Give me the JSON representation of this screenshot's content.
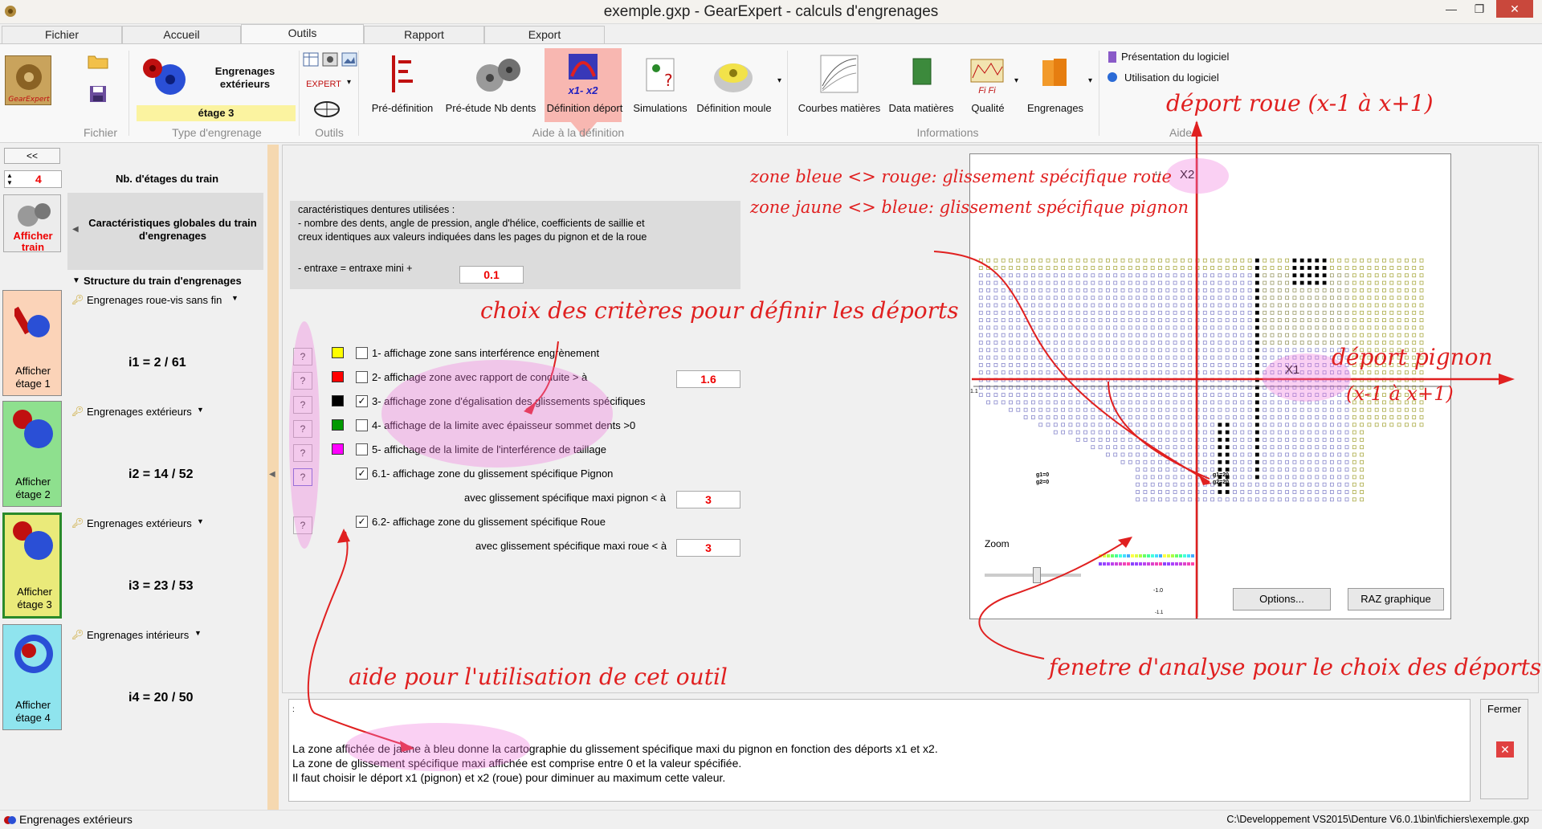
{
  "window": {
    "title": "exemple.gxp - GearExpert - calculs d'engrenages",
    "min": "—",
    "max": "❐",
    "close": "✕"
  },
  "tabs": [
    "Fichier",
    "Accueil",
    "Outils",
    "Rapport",
    "Export"
  ],
  "ribbon": {
    "logo_text": "GearExpert",
    "engrenage_label": "Engrenages extérieurs",
    "etage_label": "étage 3",
    "expert_label": "EXPERT",
    "btn_predef": "Pré-définition",
    "btn_preetude": "Pré-étude Nb dents",
    "btn_defdeport": "Définition déport",
    "btn_defdeport_icon": "x1- x2",
    "btn_simul": "Simulations",
    "btn_moule": "Définition moule",
    "btn_courbes": "Courbes matières",
    "btn_data": "Data matières",
    "btn_qualite": "Qualité",
    "btn_qualite_icon": "Fi Fi",
    "btn_engrenages": "Engrenages",
    "help_presentation": "Présentation du logiciel",
    "help_utilisation": "Utilisation du logiciel",
    "groups": [
      "Fichier",
      "Type d'engrenage",
      "Outils",
      "Aide à la définition",
      "Informations",
      "Aide"
    ]
  },
  "sidebar": {
    "collapse_btn": "<<",
    "nb_etages_value": "4",
    "nb_etages_label": "Nb. d'étages du train",
    "afficher_train": "Afficher train",
    "carac_label": "Caractéristiques globales du train d'engrenages",
    "structure_label": "Structure du train d'engrenages",
    "stages": [
      {
        "type": "Engrenages roue-vis sans fin",
        "ratio": "i1 = 2 / 61",
        "btn": "Afficher étage 1",
        "color": "#fbd3b8"
      },
      {
        "type": "Engrenages extérieurs",
        "ratio": "i2 = 14 / 52",
        "btn": "Afficher étage 2",
        "color": "#8ee08e"
      },
      {
        "type": "Engrenages extérieurs",
        "ratio": "i3 = 23 / 53",
        "btn": "Afficher étage 3",
        "color": "#eaea7a"
      },
      {
        "type": "Engrenages intérieurs",
        "ratio": "i4 = 20 / 50",
        "btn": "Afficher étage 4",
        "color": "#8fe4ee"
      }
    ]
  },
  "info": {
    "line1": "caractéristiques dentures utilisées :",
    "line2": "- nombre des dents, angle de pression, angle d'hélice, coefficients de saillie et",
    "line3": "creux identiques aux valeurs indiquées dans les pages du pignon et de la roue",
    "entraxe_label": "- entraxe = entraxe mini +",
    "entraxe_value": "0.1"
  },
  "criteria": [
    {
      "label": "1- affichage zone sans interférence engrènement",
      "swatch": "#ffff00",
      "checked": false
    },
    {
      "label": "2- affichage zone avec rapport de conduite > à",
      "swatch": "#ff0000",
      "checked": false,
      "value": "1.6"
    },
    {
      "label": "3- affichage zone d'égalisation des glissements spécifiques",
      "swatch": "#000000",
      "checked": true
    },
    {
      "label": "4- affichage de la limite avec épaisseur sommet dents >0",
      "swatch": "#009900",
      "checked": false
    },
    {
      "label": "5- affichage de la limite de l'interférence de taillage",
      "swatch": "#ff00ff",
      "checked": false
    },
    {
      "label": "6.1- affichage zone du glissement spécifique Pignon",
      "checked": true
    },
    {
      "label": "6.2- affichage zone du glissement spécifique Roue",
      "checked": true
    }
  ],
  "gs_pignon_label": "avec glissement spécifique maxi pignon < à",
  "gs_pignon_value": "3",
  "gs_roue_label": "avec glissement spécifique maxi roue < à",
  "gs_roue_value": "3",
  "qbtn": "?",
  "check": "✓",
  "graph": {
    "x2": "X2",
    "x1": "X1",
    "zoom": "Zoom",
    "options": "Options...",
    "raz": "RAZ graphique",
    "tick_top": "1.1",
    "tick_bottom": "-1.1",
    "tick_mid": "-1.0",
    "tick_left": "1.1",
    "pt_a1": "g1=0",
    "pt_a2": "g2=0",
    "pt_b1": "g1=20",
    "pt_b2": "g2=20"
  },
  "help": {
    "prefix": ":",
    "line1": "La zone affichée de jaune à bleu donne la cartographie du glissement spécifique maxi du pignon en fonction des déports x1 et x2.",
    "line2": "La zone de glissement spécifique maxi affichée est comprise entre 0 et la valeur spécifiée.",
    "line3": "Il faut choisir le déport x1 (pignon) et x2 (roue) pour diminuer au maximum cette valeur.",
    "fermer": "Fermer",
    "close_icon": "✕"
  },
  "status": {
    "left": "Engrenages extérieurs",
    "right": "C:\\Developpement VS2015\\Denture V6.0.1\\bin\\fichiers\\exemple.gxp"
  },
  "annotations": {
    "deport_roue": "déport roue (x-1 à x+1)",
    "zone_bleue": "zone bleue <> rouge: glissement spécifique roue",
    "zone_jaune": "zone jaune <> bleue: glissement spécifique pignon",
    "choix": "choix des critères pour définir les déports",
    "deport_pignon": "déport pignon",
    "deport_pignon_range": "(x-1 à x+1)",
    "aide": "aide pour l'utilisation de cet outil",
    "fenetre": "fenetre d'analyse pour le choix des déports"
  },
  "colors": {
    "annotation": "#e02020",
    "highlight": "#f07adc",
    "accent": "#c62828"
  }
}
